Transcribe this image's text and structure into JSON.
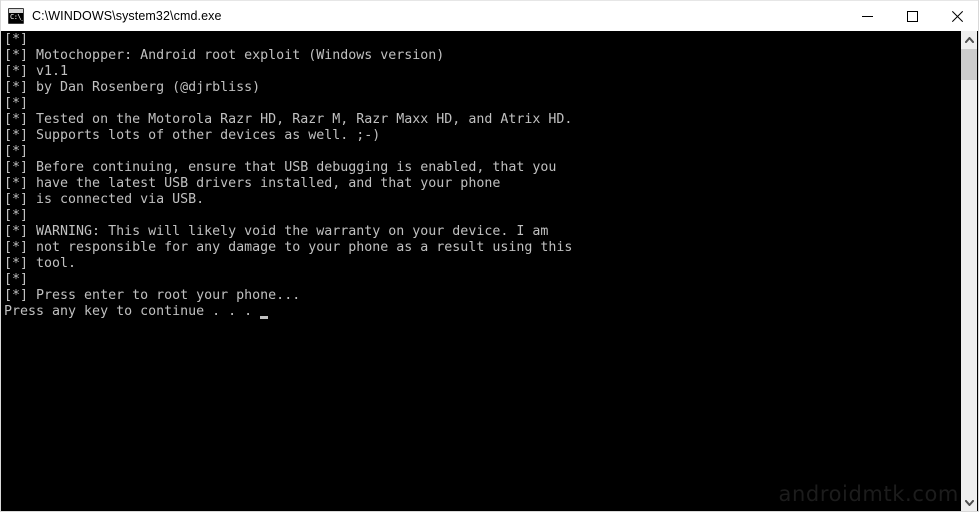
{
  "window": {
    "title": "C:\\WINDOWS\\system32\\cmd.exe",
    "icon": "cmd-console-icon",
    "icon_prompt_text": "C:\\_",
    "background_color": "#000000",
    "titlebar_color": "#ffffff"
  },
  "caption_buttons": {
    "minimize_label": "Minimize",
    "maximize_label": "Maximize",
    "close_label": "Close"
  },
  "console": {
    "foreground_color": "#c0c0c0",
    "background_color": "#000000",
    "cursor": "block-underscore",
    "text": "[*]\n[*] Motochopper: Android root exploit (Windows version)\n[*] v1.1\n[*] by Dan Rosenberg (@djrbliss)\n[*]\n[*] Tested on the Motorola Razr HD, Razr M, Razr Maxx HD, and Atrix HD.\n[*] Supports lots of other devices as well. ;-)\n[*]\n[*] Before continuing, ensure that USB debugging is enabled, that you\n[*] have the latest USB drivers installed, and that your phone\n[*] is connected via USB.\n[*]\n[*] WARNING: This will likely void the warranty on your device. I am\n[*] not responsible for any damage to your phone as a result using this\n[*] tool.\n[*]\n[*] Press enter to root your phone...\nPress any key to continue . . . ",
    "lines": [
      "[*]",
      "[*] Motochopper: Android root exploit (Windows version)",
      "[*] v1.1",
      "[*] by Dan Rosenberg (@djrbliss)",
      "[*]",
      "[*] Tested on the Motorola Razr HD, Razr M, Razr Maxx HD, and Atrix HD.",
      "[*] Supports lots of other devices as well. ;-)",
      "[*]",
      "[*] Before continuing, ensure that USB debugging is enabled, that you",
      "[*] have the latest USB drivers installed, and that your phone",
      "[*] is connected via USB.",
      "[*]",
      "[*] WARNING: This will likely void the warranty on your device. I am",
      "[*] not responsible for any damage to your phone as a result using this",
      "[*] tool.",
      "[*]",
      "[*] Press enter to root your phone...",
      "Press any key to continue . . . "
    ]
  },
  "scrollbar": {
    "up_arrow": "chevron-up-icon",
    "down_arrow": "chevron-down-icon",
    "thumb_color": "#cdcdcd",
    "track_color": "#efefef"
  },
  "watermark": {
    "text": "androidmtk.com",
    "color": "#1c1c1c"
  }
}
